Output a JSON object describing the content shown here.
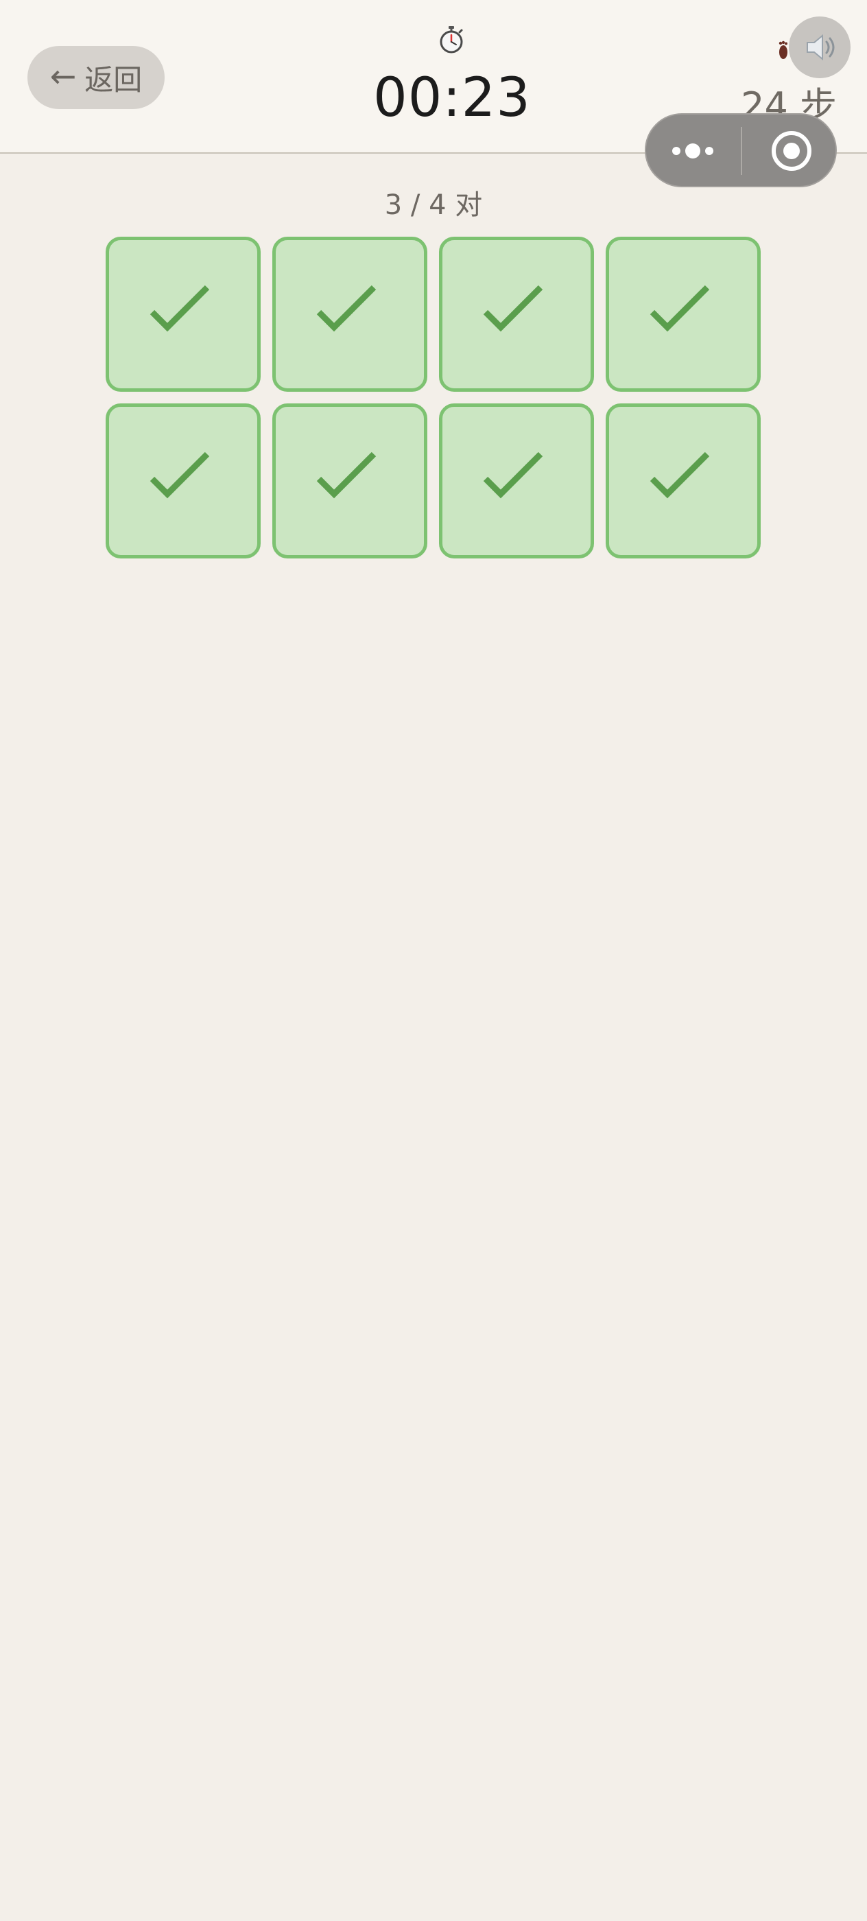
{
  "header": {
    "back_label": "返回",
    "back_arrow": "←",
    "timer_icon": "stopwatch-icon",
    "timer": "00:23",
    "steps_icon": "footsteps-icon",
    "steps": "24 步",
    "sound_icon": "speaker-icon"
  },
  "capsule": {
    "more_icon": "more-dots-icon",
    "close_icon": "target-close-icon"
  },
  "progress": {
    "text": "3 / 4 对",
    "matched_pairs": 3,
    "total_pairs": 4
  },
  "cards": [
    {
      "state": "matched",
      "icon": "checkmark-icon"
    },
    {
      "state": "matched",
      "icon": "checkmark-icon"
    },
    {
      "state": "matched",
      "icon": "checkmark-icon"
    },
    {
      "state": "matched",
      "icon": "checkmark-icon"
    },
    {
      "state": "matched",
      "icon": "checkmark-icon"
    },
    {
      "state": "matched",
      "icon": "checkmark-icon"
    },
    {
      "state": "matched",
      "icon": "checkmark-icon"
    },
    {
      "state": "matched",
      "icon": "checkmark-icon"
    }
  ],
  "colors": {
    "background": "#f3efe9",
    "header": "#f8f5f0",
    "card_fill": "#cbe6c2",
    "card_border": "#7dc271",
    "check": "#5a9e4c"
  }
}
